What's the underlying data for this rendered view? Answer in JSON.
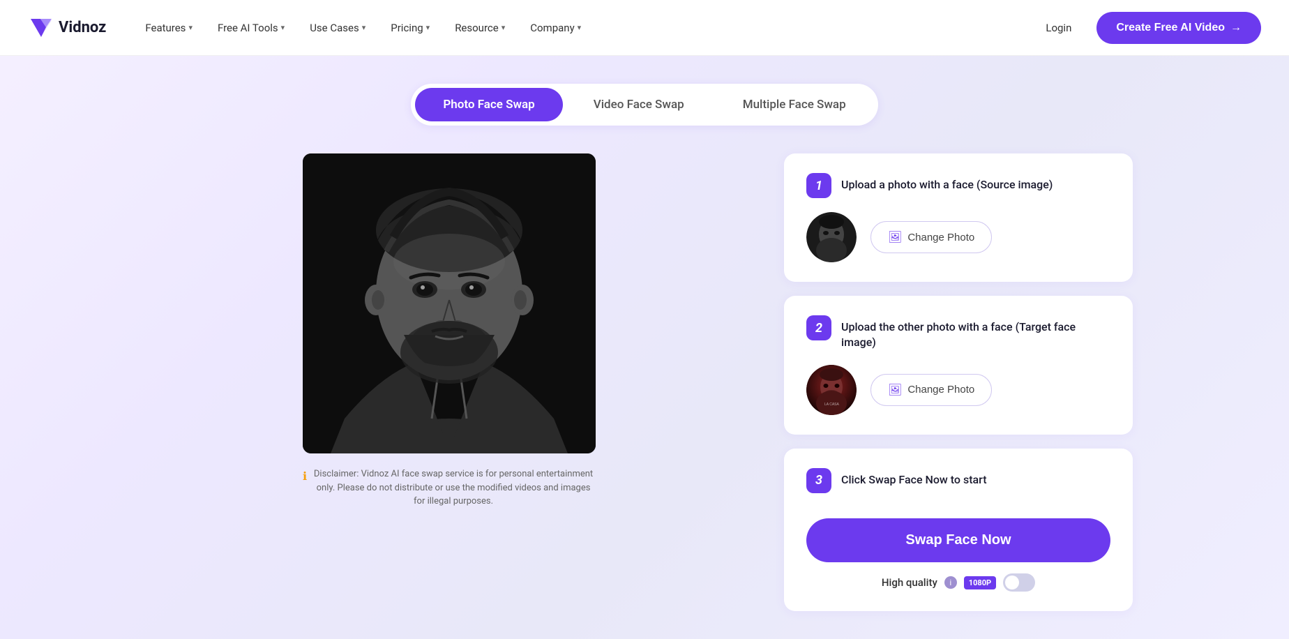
{
  "header": {
    "logo_text": "Vidnoz",
    "nav_items": [
      {
        "label": "Features",
        "has_dropdown": true
      },
      {
        "label": "Free AI Tools",
        "has_dropdown": true
      },
      {
        "label": "Use Cases",
        "has_dropdown": true
      },
      {
        "label": "Pricing",
        "has_dropdown": true
      },
      {
        "label": "Resource",
        "has_dropdown": true
      },
      {
        "label": "Company",
        "has_dropdown": true
      }
    ],
    "login_label": "Login",
    "cta_label": "Create Free AI Video",
    "cta_arrow": "→"
  },
  "tabs": [
    {
      "label": "Photo Face Swap",
      "active": true
    },
    {
      "label": "Video Face Swap",
      "active": false
    },
    {
      "label": "Multiple Face Swap",
      "active": false
    }
  ],
  "steps": {
    "step1": {
      "number": "1",
      "title": "Upload a photo with a face (Source image)",
      "change_btn_label": "Change Photo"
    },
    "step2": {
      "number": "2",
      "title": "Upload the other photo with a face (Target face image)",
      "change_btn_label": "Change Photo"
    },
    "step3": {
      "number": "3",
      "title": "Click Swap Face Now to start",
      "swap_btn_label": "Swap Face Now",
      "quality_label": "High quality",
      "quality_badge": "1080P"
    }
  },
  "disclaimer": {
    "icon": "ℹ",
    "text": "Disclaimer: Vidnoz AI face swap service is for personal entertainment only. Please do not distribute or use the modified videos and images for illegal purposes."
  },
  "icons": {
    "chevron": "▾",
    "image_icon": "🖼",
    "info_icon": "i",
    "arrow_right": "→"
  }
}
